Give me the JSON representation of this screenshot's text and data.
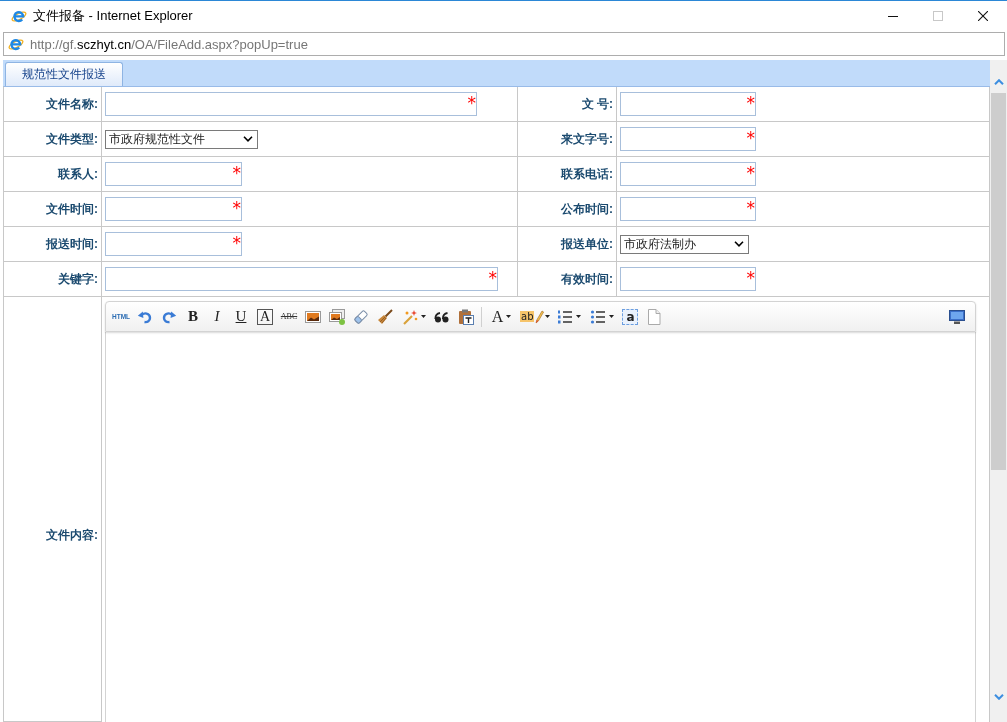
{
  "window": {
    "title": "文件报备 - Internet Explorer",
    "controls": [
      {
        "kind": "minimize",
        "disabled": false
      },
      {
        "kind": "maximize",
        "disabled": true
      },
      {
        "kind": "close",
        "disabled": false
      }
    ]
  },
  "address_bar": {
    "url_parts": [
      {
        "text": "http://gf.",
        "emphasis": false
      },
      {
        "text": "sczhyt.cn",
        "emphasis": true
      },
      {
        "text": "/OA/FileAdd.aspx?popUp=true",
        "emphasis": false
      }
    ]
  },
  "tabs": [
    {
      "label": "规范性文件报送",
      "selected": true
    }
  ],
  "form": {
    "rows": [
      [
        {
          "label": "文件名称:",
          "field": {
            "kind": "text",
            "marker": "*"
          }
        },
        {
          "label": "文 号:",
          "field": {
            "kind": "text",
            "marker": "*"
          }
        }
      ],
      [
        {
          "label": "文件类型:",
          "field": {
            "kind": "select",
            "value": "市政府规范性文件"
          }
        },
        {
          "label": "来文字号:",
          "field": {
            "kind": "text",
            "marker": "*"
          }
        }
      ],
      [
        {
          "label": "联系人:",
          "field": {
            "kind": "text",
            "marker": "*"
          }
        },
        {
          "label": "联系电话:",
          "field": {
            "kind": "text",
            "marker": "*"
          }
        }
      ],
      [
        {
          "label": "文件时间:",
          "field": {
            "kind": "text",
            "marker": "*"
          }
        },
        {
          "label": "公布时间:",
          "field": {
            "kind": "text",
            "marker": "*"
          }
        }
      ],
      [
        {
          "label": "报送时间:",
          "field": {
            "kind": "text",
            "marker": "*"
          }
        },
        {
          "label": "报送单位:",
          "field": {
            "kind": "select",
            "value": "市政府法制办"
          }
        }
      ],
      [
        {
          "label": "关键字:",
          "field": {
            "kind": "text",
            "marker": "*"
          }
        },
        {
          "label": "有效时间:",
          "field": {
            "kind": "text",
            "marker": "*"
          }
        }
      ]
    ],
    "editor": {
      "label": "文件内容:",
      "toolbar": {
        "groups": [
          [
            {
              "kind": "html",
              "label": "HTML",
              "menu": false
            },
            {
              "kind": "undo",
              "menu": false
            },
            {
              "kind": "redo",
              "menu": false
            },
            {
              "kind": "bold",
              "label": "B",
              "menu": false
            },
            {
              "kind": "italic",
              "label": "I",
              "menu": false
            },
            {
              "kind": "underline",
              "label": "U",
              "menu": false
            },
            {
              "kind": "border",
              "label": "A",
              "menu": false
            },
            {
              "kind": "strikethrough",
              "label": "ABC",
              "menu": false
            },
            {
              "kind": "image",
              "menu": false
            },
            {
              "kind": "multi-image",
              "menu": false
            },
            {
              "kind": "eraser",
              "menu": false
            },
            {
              "kind": "brush",
              "menu": false
            },
            {
              "kind": "wand",
              "menu": true
            },
            {
              "kind": "quote",
              "menu": false
            },
            {
              "kind": "paste",
              "menu": false
            }
          ],
          [
            {
              "kind": "font-color",
              "label": "A",
              "menu": true
            },
            {
              "kind": "highlight",
              "label": "ab",
              "menu": true
            },
            {
              "kind": "numbered-list",
              "menu": true
            },
            {
              "kind": "bullet-list",
              "menu": true
            },
            {
              "kind": "anchor",
              "label": "a",
              "menu": false
            },
            {
              "kind": "page",
              "menu": false
            }
          ]
        ],
        "end": [
          {
            "kind": "preview",
            "menu": false
          }
        ]
      }
    }
  }
}
